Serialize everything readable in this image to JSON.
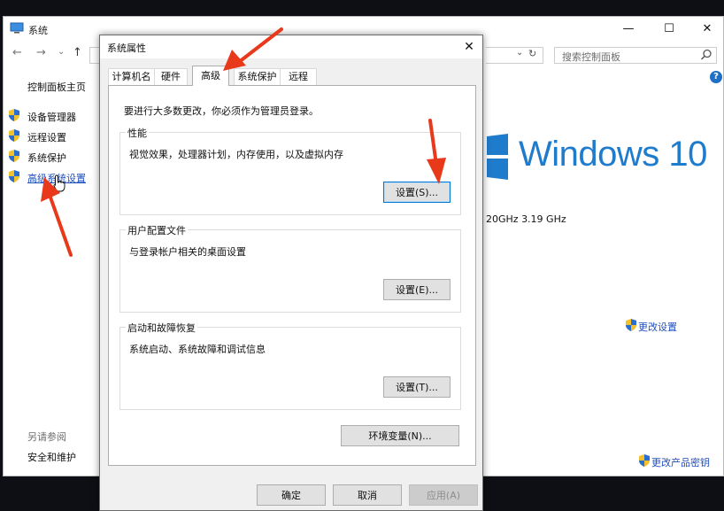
{
  "bg_window": {
    "title": "系统",
    "controls": {
      "minimize": "—",
      "maximize": "☐",
      "close": "✕"
    },
    "nav": {
      "back": "←",
      "forward": "→",
      "dropdown": "⌄",
      "up": "↑"
    },
    "address_dropdown": "⌄",
    "address_refresh": "↻",
    "search_placeholder": "搜索控制面板",
    "help_label": "?",
    "sidebar": {
      "home": "控制面板主页",
      "links": [
        {
          "label": "设备管理器"
        },
        {
          "label": "远程设置"
        },
        {
          "label": "系统保护"
        },
        {
          "label": "高级系统设置"
        }
      ],
      "see_also": "另请参阅",
      "security": "安全和维护"
    },
    "windows_logo_text": "Windows 10",
    "cpu_freq": "20GHz   3.19 GHz",
    "change_settings": "更改设置",
    "change_product_key": "更改产品密钥"
  },
  "dialog": {
    "title": "系统属性",
    "close": "✕",
    "tabs": [
      {
        "label": "计算机名"
      },
      {
        "label": "硬件"
      },
      {
        "label": "高级",
        "selected": true
      },
      {
        "label": "系统保护"
      },
      {
        "label": "远程"
      }
    ],
    "admin_note": "要进行大多数更改，你必须作为管理员登录。",
    "groups": {
      "performance": {
        "title": "性能",
        "desc": "视觉效果，处理器计划，内存使用，以及虚拟内存",
        "button": "设置(S)..."
      },
      "profiles": {
        "title": "用户配置文件",
        "desc": "与登录帐户相关的桌面设置",
        "button": "设置(E)..."
      },
      "startup": {
        "title": "启动和故障恢复",
        "desc": "系统启动、系统故障和调试信息",
        "button": "设置(T)..."
      }
    },
    "env_button": "环境变量(N)...",
    "ok": "确定",
    "cancel": "取消",
    "apply": "应用(A)"
  },
  "colors": {
    "link_blue": "#1f4fbd",
    "windows_blue": "#1f7bcc",
    "annotation_red": "#e8391b",
    "focus_blue": "#0078d7"
  }
}
